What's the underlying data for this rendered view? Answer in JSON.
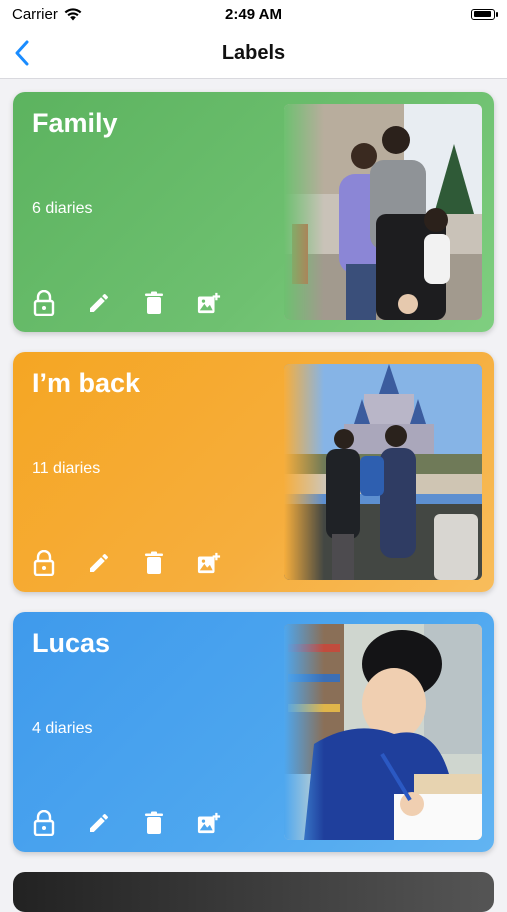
{
  "status": {
    "carrier": "Carrier",
    "time": "2:49 AM",
    "battery_level": 0.9
  },
  "nav": {
    "title": "Labels",
    "back_icon": "chevron-left-icon"
  },
  "colors": {
    "accent": "#1a8cff",
    "family": "#5cb35f",
    "back": "#f5a623",
    "lucas": "#3f9aec"
  },
  "labels": [
    {
      "title": "Family",
      "count": "6 diaries"
    },
    {
      "title": "I’m back",
      "count": "11 diaries"
    },
    {
      "title": "Lucas",
      "count": "4 diaries"
    }
  ],
  "actions": [
    "lock-icon",
    "edit-icon",
    "trash-icon",
    "add-photo-icon"
  ]
}
